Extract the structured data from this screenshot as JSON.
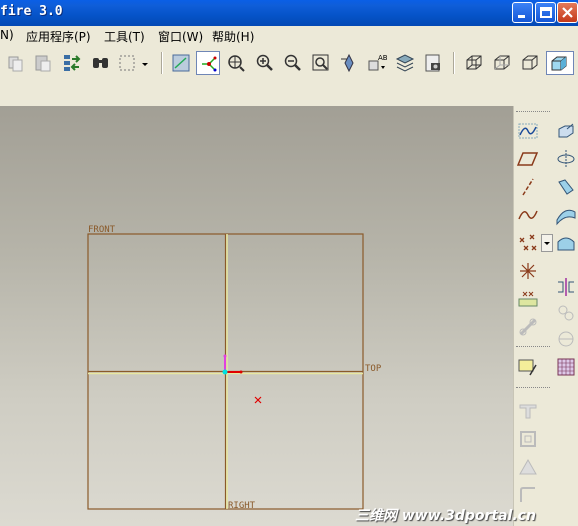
{
  "window": {
    "title": "fire 3.0"
  },
  "menu": [
    {
      "label": "N)"
    },
    {
      "label": "应用程序(P)"
    },
    {
      "label": "工具(T)"
    },
    {
      "label": "窗口(W)"
    },
    {
      "label": "帮助(H)"
    }
  ],
  "toolbar_icons": [
    "copy-icon",
    "paste-icon",
    "regenerate-icon",
    "find-icon",
    "select-box-icon",
    "datum-display-icon",
    "spin-center-icon",
    "orient-icon",
    "zoom-in-icon",
    "zoom-out-icon",
    "refit-icon",
    "repaint-icon",
    "named-view-icon",
    "layers-icon",
    "view-manager-icon",
    "wireframe-icon",
    "hidden-line-icon",
    "no-hidden-icon",
    "shading-icon"
  ],
  "datum_planes": {
    "front": "FRONT",
    "top": "TOP",
    "right": "RIGHT"
  },
  "watermark": "三维网 www.3dportal.cn",
  "colors": {
    "titlebar": "#0553c8",
    "datum_plane": "#8a5a2a",
    "datum_axis": "#e8e8a0",
    "csys_pink": "#e040e0",
    "csys_red": "#e00000",
    "csys_cyan": "#00e0e0"
  }
}
